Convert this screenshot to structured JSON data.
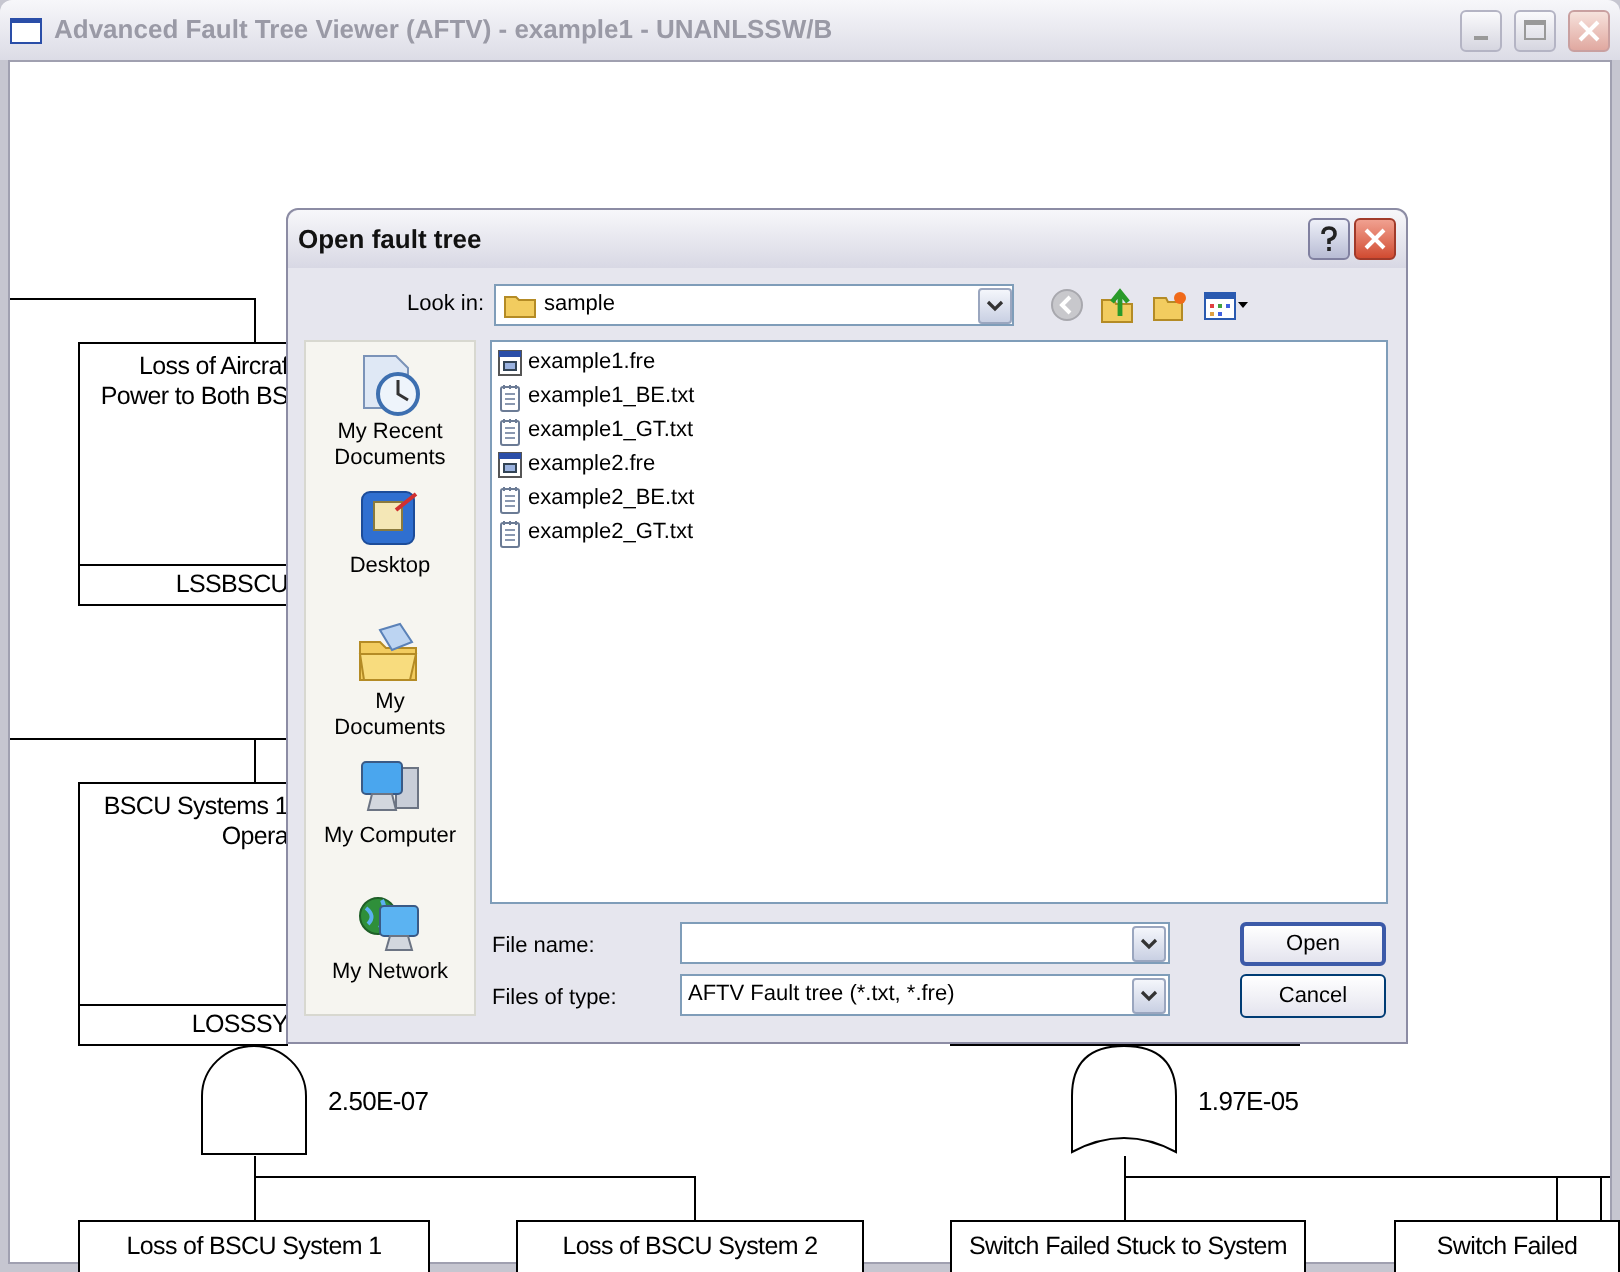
{
  "window": {
    "title": "Advanced Fault Tree Viewer (AFTV) - example1 - UNANLSSW/B"
  },
  "fault_tree": {
    "events": [
      {
        "lines": [
          "Loss of Aircraf",
          "Power to Both BS"
        ],
        "id": "LSSBSCU"
      },
      {
        "lines": [
          "BSCU Systems 1",
          "Opera"
        ],
        "id": "LOSSSY"
      }
    ],
    "gates": [
      {
        "kind": "and",
        "probability": "2.50E-07"
      },
      {
        "kind": "or",
        "probability": "1.97E-05"
      }
    ],
    "basic_events": [
      "Loss of BSCU System 1",
      "Loss of BSCU System 2",
      "Switch Failed Stuck to System",
      "Switch Failed"
    ]
  },
  "dialog": {
    "title": "Open fault tree",
    "look_in_label": "Look in:",
    "look_in_value": "sample",
    "places": [
      {
        "kind": "recent",
        "label": "My Recent Documents"
      },
      {
        "kind": "desktop",
        "label": "Desktop"
      },
      {
        "kind": "documents",
        "label": "My Documents"
      },
      {
        "kind": "computer",
        "label": "My Computer"
      },
      {
        "kind": "network",
        "label": "My Network"
      }
    ],
    "files": [
      {
        "kind": "fre",
        "name": "example1.fre"
      },
      {
        "kind": "txt",
        "name": "example1_BE.txt"
      },
      {
        "kind": "txt",
        "name": "example1_GT.txt"
      },
      {
        "kind": "fre",
        "name": "example2.fre"
      },
      {
        "kind": "txt",
        "name": "example2_BE.txt"
      },
      {
        "kind": "txt",
        "name": "example2_GT.txt"
      }
    ],
    "file_name_label": "File name:",
    "files_of_type_label": "Files of type:",
    "files_of_type_value": "AFTV Fault tree (*.txt, *.fre)",
    "buttons": [
      {
        "kind": "default",
        "label": "Open"
      },
      {
        "kind": "normal",
        "label": "Cancel"
      }
    ]
  }
}
